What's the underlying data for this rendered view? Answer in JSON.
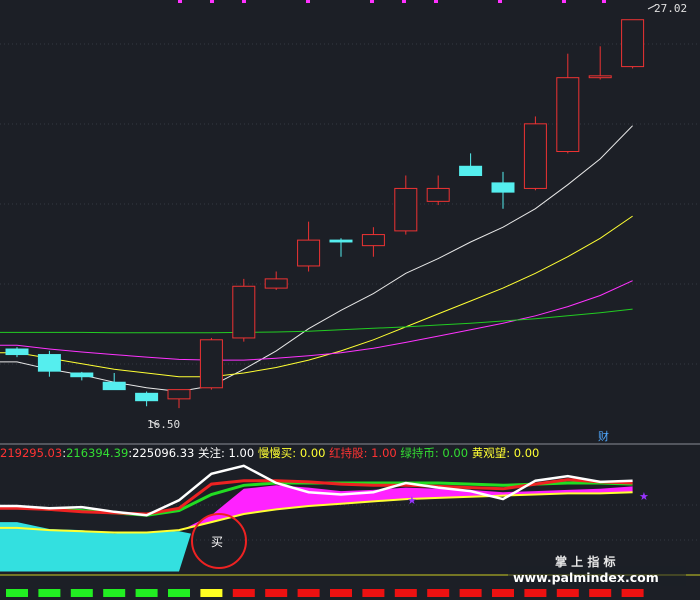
{
  "price_panel": {
    "high_marker": "27.02",
    "low_marker": "16.50",
    "finance_badge": "财"
  },
  "indicator_bar": {
    "values": [
      {
        "text": "219295.03",
        "color": "#ff3333"
      },
      {
        "text": "216394.39",
        "color": "#33dd33"
      },
      {
        "text": "225096.33",
        "color": "#ffffff"
      },
      {
        "text": "关注: 1.00",
        "color": "#ffffff"
      },
      {
        "text": "慢慢买: 0.00",
        "color": "#ffff33"
      },
      {
        "text": "红持股: 1.00",
        "color": "#ff3333"
      },
      {
        "text": "绿持币: 0.00",
        "color": "#33dd33"
      },
      {
        "text": "黄观望: 0.00",
        "color": "#ffff33"
      }
    ],
    "separator": ":"
  },
  "annotation": {
    "buy_label": "买"
  },
  "watermark": {
    "title": "掌 上 指 标",
    "url": "www.palmindex.com"
  },
  "chart_data": {
    "type": "candlestick",
    "ylim": [
      15.5,
      27.5
    ],
    "candles": [
      {
        "o": 18.1,
        "h": 18.15,
        "l": 17.88,
        "c": 17.95
      },
      {
        "o": 17.95,
        "h": 18.05,
        "l": 17.35,
        "c": 17.5
      },
      {
        "o": 17.45,
        "h": 17.48,
        "l": 17.25,
        "c": 17.35
      },
      {
        "o": 17.2,
        "h": 17.45,
        "l": 17.0,
        "c": 17.0
      },
      {
        "o": 16.9,
        "h": 16.95,
        "l": 16.55,
        "c": 16.7
      },
      {
        "o": 16.75,
        "h": 17.0,
        "l": 16.5,
        "c": 17.0
      },
      {
        "o": 17.05,
        "h": 18.4,
        "l": 17.0,
        "c": 18.35
      },
      {
        "o": 18.4,
        "h": 20.0,
        "l": 18.3,
        "c": 19.8
      },
      {
        "o": 19.75,
        "h": 20.2,
        "l": 19.7,
        "c": 20.0
      },
      {
        "o": 20.35,
        "h": 21.55,
        "l": 20.2,
        "c": 21.05
      },
      {
        "o": 21.05,
        "h": 21.1,
        "l": 20.6,
        "c": 21.0
      },
      {
        "o": 20.9,
        "h": 21.4,
        "l": 20.6,
        "c": 21.2
      },
      {
        "o": 21.3,
        "h": 22.8,
        "l": 21.2,
        "c": 22.45
      },
      {
        "o": 22.1,
        "h": 22.8,
        "l": 22.0,
        "c": 22.45
      },
      {
        "o": 23.05,
        "h": 23.4,
        "l": 22.8,
        "c": 22.8
      },
      {
        "o": 22.6,
        "h": 22.9,
        "l": 21.9,
        "c": 22.35
      },
      {
        "o": 22.45,
        "h": 24.4,
        "l": 22.4,
        "c": 24.2
      },
      {
        "o": 23.45,
        "h": 26.1,
        "l": 23.4,
        "c": 25.45
      },
      {
        "o": 25.45,
        "h": 26.3,
        "l": 25.4,
        "c": 25.5
      },
      {
        "o": 25.75,
        "h": 27.02,
        "l": 25.7,
        "c": 27.02
      }
    ],
    "ma_lines": [
      {
        "color": "#e8e8e8",
        "values": [
          17.75,
          17.55,
          17.4,
          17.2,
          17.05,
          16.95,
          17.1,
          17.55,
          18.05,
          18.65,
          19.15,
          19.6,
          20.15,
          20.55,
          21.0,
          21.4,
          21.9,
          22.55,
          23.25,
          24.15
        ]
      },
      {
        "color": "#ffff33",
        "values": [
          18.0,
          17.85,
          17.7,
          17.55,
          17.45,
          17.35,
          17.35,
          17.45,
          17.6,
          17.8,
          18.05,
          18.35,
          18.7,
          19.05,
          19.4,
          19.75,
          20.15,
          20.6,
          21.1,
          21.7
        ]
      },
      {
        "color": "#ff33ff",
        "values": [
          18.2,
          18.1,
          18.02,
          17.95,
          17.88,
          17.82,
          17.8,
          17.8,
          17.85,
          17.92,
          18.0,
          18.12,
          18.28,
          18.45,
          18.62,
          18.8,
          19.0,
          19.25,
          19.55,
          19.95
        ]
      },
      {
        "color": "#22cc22",
        "values": [
          18.55,
          18.55,
          18.55,
          18.54,
          18.54,
          18.54,
          18.54,
          18.55,
          18.56,
          18.58,
          18.62,
          18.66,
          18.7,
          18.75,
          18.8,
          18.86,
          18.92,
          19.0,
          19.08,
          19.18
        ]
      }
    ],
    "indicator": {
      "ylim": [
        0,
        10
      ],
      "white": [
        6.0,
        5.8,
        5.9,
        5.5,
        5.2,
        6.5,
        8.8,
        9.5,
        8.0,
        7.2,
        7.0,
        7.2,
        8.0,
        7.6,
        7.3,
        6.6,
        8.2,
        8.6,
        8.1,
        8.2
      ],
      "red": [
        5.8,
        5.7,
        5.5,
        5.4,
        5.3,
        5.8,
        7.9,
        8.2,
        8.2,
        8.1,
        7.9,
        7.8,
        7.8,
        7.7,
        7.6,
        7.5,
        7.9,
        8.3,
        8.1,
        8.0
      ],
      "green": [
        5.9,
        5.7,
        5.6,
        5.4,
        5.2,
        5.6,
        7.0,
        7.8,
        8.0,
        8.0,
        8.0,
        8.0,
        8.0,
        8.0,
        7.9,
        7.8,
        7.9,
        8.0,
        8.0,
        7.9
      ],
      "yellow": [
        4.1,
        3.9,
        3.8,
        3.7,
        3.7,
        3.9,
        4.6,
        5.3,
        5.7,
        6.0,
        6.2,
        6.4,
        6.6,
        6.7,
        6.8,
        6.9,
        7.0,
        7.1,
        7.1,
        7.2
      ],
      "magenta_top": [
        null,
        null,
        null,
        null,
        null,
        3.8,
        5.2,
        7.5,
        7.8,
        7.6,
        7.3,
        7.4,
        7.6,
        7.5,
        7.4,
        7.2,
        7.3,
        7.4,
        7.5,
        7.7
      ],
      "cyan_top": [
        4.6,
        4.0,
        3.9,
        3.6,
        3.7,
        3.8,
        null,
        null,
        null,
        null,
        null,
        null,
        null,
        null,
        null,
        null,
        null,
        null,
        null,
        null
      ],
      "signal_squares": [
        "green",
        "green",
        "green",
        "green",
        "green",
        "green",
        "yellow",
        "red",
        "red",
        "red",
        "red",
        "red",
        "red",
        "red",
        "red",
        "red",
        "red",
        "red",
        "red",
        "red"
      ]
    }
  }
}
